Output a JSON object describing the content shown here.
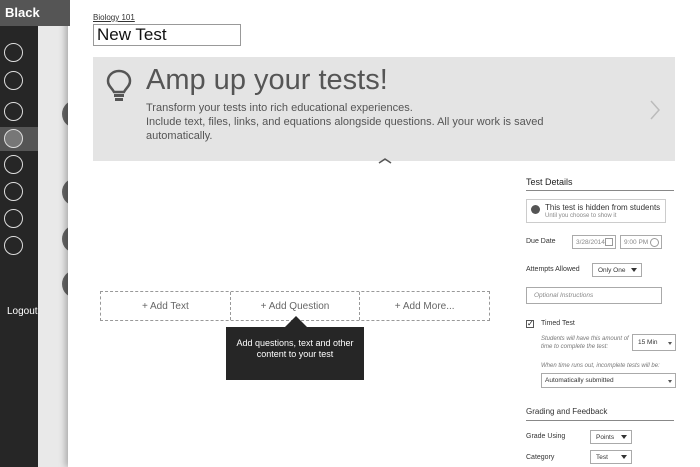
{
  "rail": {
    "title": "Black",
    "logout": "Logout"
  },
  "page": {
    "breadcrumb": "Biology 101",
    "title_value": "New Test"
  },
  "banner": {
    "heading": "Amp up your tests!",
    "line1": "Transform your tests into rich educational experiences.",
    "line2": "Include text, files, links, and equations alongside questions. All your work is saved automatically."
  },
  "add_bar": {
    "add_text": "+ Add Text",
    "add_question": "+ Add Question",
    "add_more": "+ Add More..."
  },
  "tooltip": {
    "text": "Add questions, text and other content to your test"
  },
  "details": {
    "title": "Test Details",
    "visibility_main": "This test is hidden from students",
    "visibility_sub": "Until you choose to show it",
    "due_date_label": "Due Date",
    "due_date_value": "3/28/2014",
    "due_time_value": "9:00 PM",
    "attempts_label": "Attempts Allowed",
    "attempts_value": "Only One",
    "instructions_placeholder": "Optional Instructions",
    "timed_label": "Timed Test",
    "timed_note": "Students will have this amount of time to complete the test:",
    "timed_value": "15 Min",
    "timeout_note": "When time runs out, incomplete tests will be:",
    "timeout_value": "Automatically submitted"
  },
  "grading": {
    "title": "Grading and Feedback",
    "grade_using_label": "Grade Using",
    "grade_using_value": "Points",
    "category_label": "Category",
    "category_value": "Test"
  }
}
